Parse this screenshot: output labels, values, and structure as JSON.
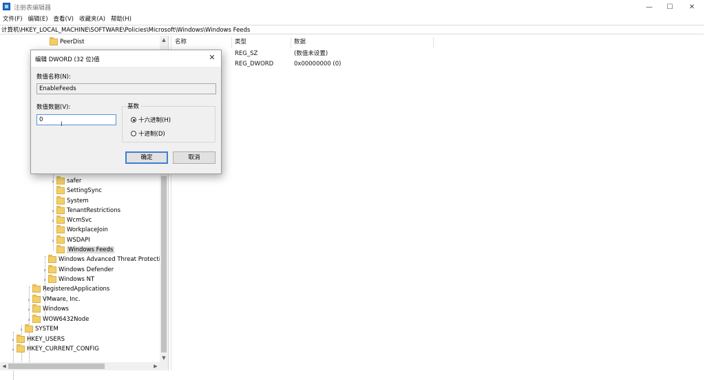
{
  "window": {
    "title": "注册表编辑器",
    "controls": {
      "minimize": "—",
      "maximize": "☐",
      "close": "✕"
    }
  },
  "menu": [
    "文件(F)",
    "编辑(E)",
    "查看(V)",
    "收藏夹(A)",
    "帮助(H)"
  ],
  "address": "计算机\\HKEY_LOCAL_MACHINE\\SOFTWARE\\Policies\\Microsoft\\Windows\\Windows Feeds",
  "tree": {
    "top_item": "PeerDist",
    "items": [
      {
        "label": "safer",
        "expandable": true
      },
      {
        "label": "SettingSync",
        "expandable": false
      },
      {
        "label": "System",
        "expandable": false
      },
      {
        "label": "TenantRestrictions",
        "expandable": true
      },
      {
        "label": "WcmSvc",
        "expandable": true
      },
      {
        "label": "WorkplaceJoin",
        "expandable": false
      },
      {
        "label": "WSDAPI",
        "expandable": true
      },
      {
        "label": "Windows Feeds",
        "expandable": false,
        "selected": true
      },
      {
        "label": "Windows Advanced Threat Protecti",
        "expandable": false
      },
      {
        "label": "Windows Defender",
        "expandable": true
      },
      {
        "label": "Windows NT",
        "expandable": true
      },
      {
        "label": "RegisteredApplications",
        "expandable": false
      },
      {
        "label": "VMware, Inc.",
        "expandable": true
      },
      {
        "label": "Windows",
        "expandable": true
      },
      {
        "label": "WOW6432Node",
        "expandable": true
      },
      {
        "label": "SYSTEM",
        "expandable": true
      },
      {
        "label": "HKEY_USERS",
        "expandable": true
      },
      {
        "label": "HKEY_CURRENT_CONFIG",
        "expandable": true
      }
    ]
  },
  "list": {
    "columns": [
      "名称",
      "类型",
      "数据"
    ],
    "rows": [
      {
        "type": "REG_SZ",
        "data": "(数值未设置)"
      },
      {
        "type": "REG_DWORD",
        "data": "0x00000000 (0)"
      }
    ]
  },
  "dialog": {
    "title": "编辑 DWORD (32 位)值",
    "name_label": "数值名称(N):",
    "name_value": "EnableFeeds",
    "data_label": "数值数据(V):",
    "data_value": "0",
    "base_label": "基数",
    "radio_hex": "十六进制(H)",
    "radio_dec": "十进制(D)",
    "selected_base": "hex",
    "ok_label": "确定",
    "cancel_label": "取消",
    "close_glyph": "✕"
  }
}
